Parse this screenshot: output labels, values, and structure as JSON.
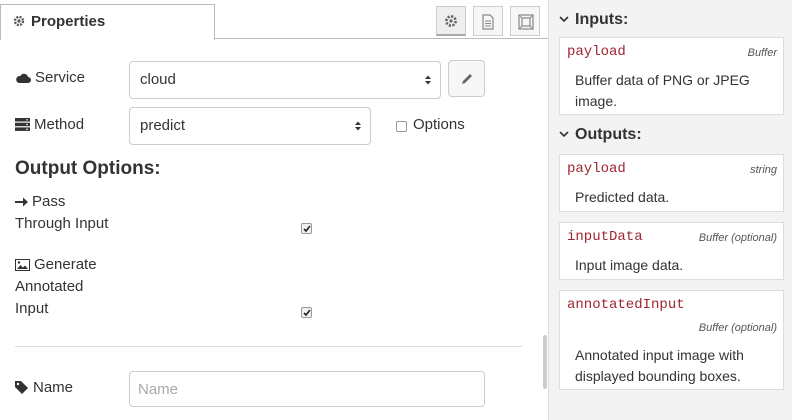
{
  "tabs": {
    "properties_label": "Properties"
  },
  "service": {
    "label": "Service",
    "value": "cloud"
  },
  "method": {
    "label": "Method",
    "value": "predict",
    "options_label": "Options",
    "options_checked": false
  },
  "output_options": {
    "heading": "Output Options:",
    "pass_through": {
      "label_line1": "Pass",
      "label_line2": "Through Input",
      "checked": true
    },
    "annotated": {
      "label_line1": "Generate",
      "label_line2": "Annotated",
      "label_line3": "Input",
      "checked": true
    }
  },
  "name": {
    "label": "Name",
    "placeholder": "Name",
    "value": ""
  },
  "help": {
    "inputs_title": "Inputs:",
    "inputs": [
      {
        "name": "payload",
        "type": "Buffer",
        "desc_line1": "Buffer data of PNG or JPEG",
        "desc_line2": "image."
      }
    ],
    "outputs_title": "Outputs:",
    "outputs": [
      {
        "name": "payload",
        "type": "string",
        "desc_line1": "Predicted data."
      },
      {
        "name": "inputData",
        "type": "Buffer (optional)",
        "desc_line1": "Input image data."
      },
      {
        "name": "annotatedInput",
        "type": "Buffer (optional)",
        "desc_line1": "Annotated input image with",
        "desc_line2": "displayed bounding boxes."
      }
    ]
  },
  "icons": [
    "cog-icon",
    "file-icon",
    "frame-icon",
    "cloud-icon",
    "server-icon",
    "pencil-icon",
    "arrow-right-icon",
    "image-icon",
    "tag-icon",
    "chevron-down-icon",
    "checkmark-icon"
  ]
}
